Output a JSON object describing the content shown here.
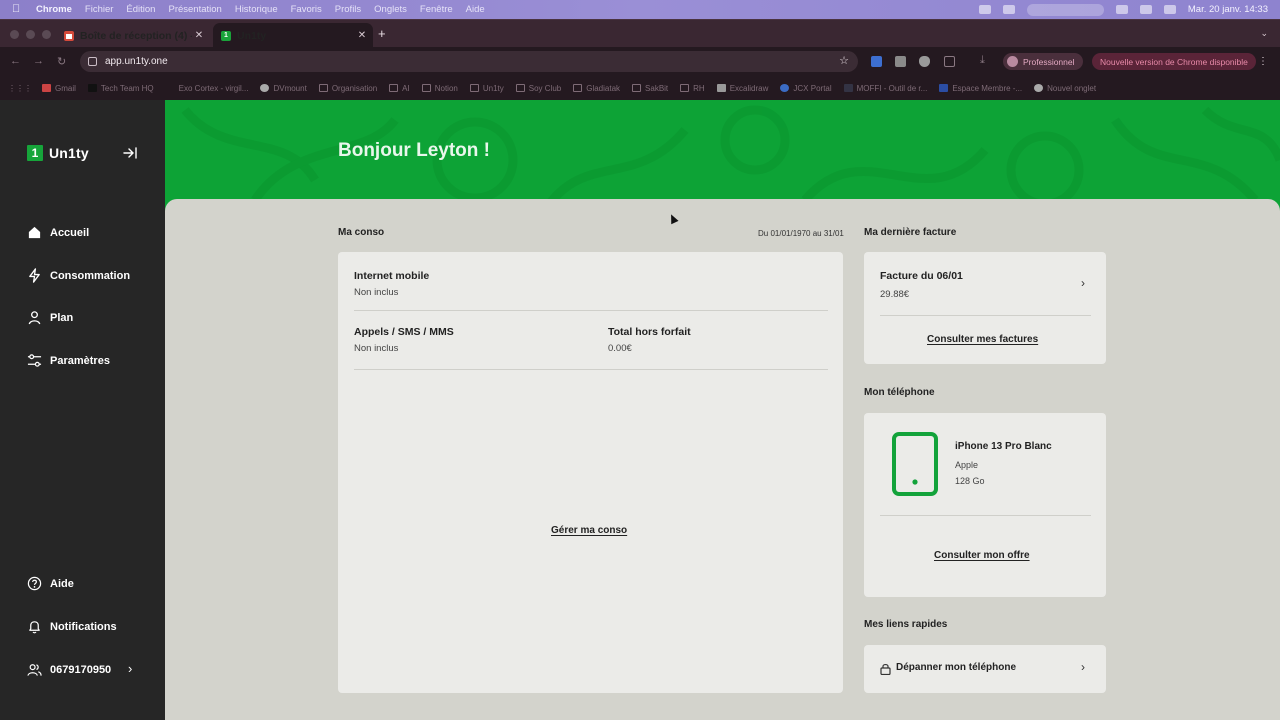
{
  "menubar": {
    "app": "Chrome",
    "items": [
      "Fichier",
      "Édition",
      "Présentation",
      "Historique",
      "Favoris",
      "Profils",
      "Onglets",
      "Fenêtre",
      "Aide"
    ],
    "clock": "Mar. 20 janv.  14:33"
  },
  "tabs": [
    {
      "title": "Boîte de réception (4) - virgi",
      "icon": "gmail-icon"
    },
    {
      "title": "Un1ty",
      "icon": "unity-icon"
    }
  ],
  "address": {
    "url": "app.un1ty.one"
  },
  "profile": {
    "label": "Professionnel"
  },
  "update": {
    "label": "Nouvelle version de Chrome disponible"
  },
  "bookmarks": [
    "Gmail",
    "Tech Team HQ",
    "Exo Cortex - virgil...",
    "DVmount",
    "Organisation",
    "AI",
    "Notion",
    "Un1ty",
    "Soy Club",
    "Gladiatak",
    "SakBit",
    "RH",
    "Excalidraw",
    "JCX Portal",
    "MOFFI - Outil de r...",
    "Espace Membre -...",
    "Nouvel onglet"
  ],
  "sidebar": {
    "logo_number": "1",
    "logo_text": "Un1ty",
    "nav": [
      {
        "label": "Accueil",
        "icon": "home-icon"
      },
      {
        "label": "Consommation",
        "icon": "bolt-icon"
      },
      {
        "label": "Plan",
        "icon": "user-icon"
      },
      {
        "label": "Paramètres",
        "icon": "sliders-icon"
      }
    ],
    "bottom": [
      {
        "label": "Aide",
        "icon": "help-icon"
      },
      {
        "label": "Notifications",
        "icon": "bell-icon"
      },
      {
        "label": "0679170950",
        "icon": "users-icon"
      }
    ]
  },
  "hero": {
    "greeting": "Bonjour Leyton !"
  },
  "conso": {
    "label": "Ma conso",
    "date_range": "Du 01/01/1970 au 31/01",
    "internet_title": "Internet mobile",
    "internet_value": "Non inclus",
    "calls_title": "Appels / SMS / MMS",
    "calls_value": "Non inclus",
    "overage_title": "Total hors forfait",
    "overage_value": "0.00€",
    "manage_link": "Gérer ma conso"
  },
  "invoice": {
    "label": "Ma dernière facture",
    "title": "Facture du 06/01",
    "amount": "29.88€",
    "link": "Consulter mes factures"
  },
  "phone": {
    "label": "Mon téléphone",
    "model": "iPhone 13 Pro Blanc",
    "brand": "Apple",
    "storage": "128 Go",
    "link": "Consulter mon offre"
  },
  "quicklinks": {
    "label": "Mes liens rapides",
    "items": [
      {
        "label": "Dépanner mon téléphone",
        "icon": "lock-icon"
      }
    ]
  },
  "colors": {
    "brand_green": "#0da336",
    "sidebar": "#262626",
    "main_bg": "#d3d3cc",
    "card_bg": "#ebebe8"
  }
}
